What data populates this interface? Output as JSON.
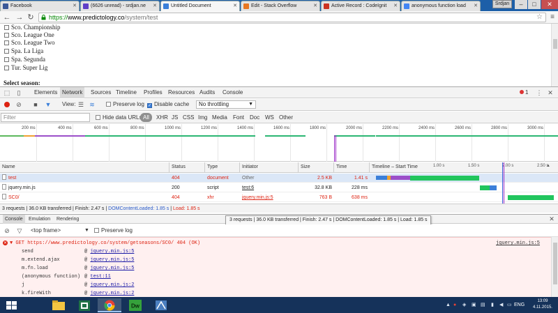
{
  "browser": {
    "tabs": [
      {
        "title": "Facebook",
        "favicon_color": "#3b5998"
      },
      {
        "title": "(6626 unread) - srdjan.ne",
        "favicon_color": "#5f3ec7"
      },
      {
        "title": "Untitled Document",
        "favicon_color": "#3b7fd9"
      },
      {
        "title": "Edit - Stack Overflow",
        "favicon_color": "#e87722"
      },
      {
        "title": "Active Record : CodeIgnit",
        "favicon_color": "#cc3322"
      },
      {
        "title": "anonymous function load",
        "favicon_color": "#4285f4"
      }
    ],
    "user_name": "Srdjan",
    "window_buttons": {
      "minimize": "–",
      "maximize": "□",
      "close": "✕"
    },
    "url": {
      "scheme": "https://",
      "host": "www.predictology.co",
      "path": "/system/test"
    }
  },
  "page": {
    "leagues": [
      "Sco. Championship",
      "Sco. League One",
      "Sco. League Two",
      "Spa. La Liga",
      "Spa. Segunda",
      "Tur. Super Lig"
    ],
    "select_season_label": "Select season:"
  },
  "devtools": {
    "tabs": [
      "Elements",
      "Network",
      "Sources",
      "Timeline",
      "Profiles",
      "Resources",
      "Audits",
      "Console"
    ],
    "active_tab": "Network",
    "error_count": "1",
    "network_toolbar": {
      "view_label": "View:",
      "preserve_log": "Preserve log",
      "disable_cache": "Disable cache",
      "throttle": "No throttling"
    },
    "filter": {
      "placeholder": "Filter",
      "hide_data_urls": "Hide data URLs",
      "types": [
        "All",
        "XHR",
        "JS",
        "CSS",
        "Img",
        "Media",
        "Font",
        "Doc",
        "WS",
        "Other"
      ]
    },
    "overview_ticks": [
      "200 ms",
      "400 ms",
      "600 ms",
      "800 ms",
      "1000 ms",
      "1200 ms",
      "1400 ms",
      "1600 ms",
      "1800 ms",
      "2000 ms",
      "2200 ms",
      "2400 ms",
      "2600 ms",
      "2800 ms",
      "3000 ms"
    ],
    "columns": [
      "Name",
      "Status",
      "Type",
      "Initiator",
      "Size",
      "Time",
      "Timeline – Start Time"
    ],
    "waterfall_ticks": [
      "1.00 s",
      "1.50 s",
      "2.00 s",
      "2.50 s"
    ],
    "requests": [
      {
        "name": "test",
        "status": "404",
        "type": "document",
        "initiator": "Other",
        "size": "2.5 KB",
        "time": "1.41 s"
      },
      {
        "name": "jquery.min.js",
        "status": "200",
        "type": "script",
        "initiator": "test:6",
        "size": "32.8 KB",
        "time": "228 ms"
      },
      {
        "name": "SC0/",
        "status": "404",
        "type": "xhr",
        "initiator": "jquery.min.js:5",
        "size": "763 B",
        "time": "638 ms"
      }
    ],
    "summary": {
      "main": "3 requests | 36.0 KB transferred | Finish: 2.47 s | ",
      "dom": "DOMContentLoaded: 1.85 s",
      "sep": " | ",
      "load": "Load: 1.85 s"
    },
    "tooltip": "3 requests | 36.0 KB transferred | Finish: 2.47 s | DOMContentLoaded: 1.85 s | Load: 1.85 s",
    "drawer_tabs": [
      "Console",
      "Emulation",
      "Rendering"
    ],
    "console": {
      "frame": "<top frame>",
      "preserve_log": "Preserve log",
      "error_line": "▼ GET https://www.predictology.co/system/getseasons/SC0/ 404 (OK)",
      "error_location": "jquery.min.js:5",
      "stack": [
        {
          "fn": "send",
          "loc": "jquery.min.js:5"
        },
        {
          "fn": "m.extend.ajax",
          "loc": "jquery.min.js:5"
        },
        {
          "fn": "m.fn.load",
          "loc": "jquery.min.js:5"
        },
        {
          "fn": "(anonymous function)",
          "loc": "test:11"
        },
        {
          "fn": "j",
          "loc": "jquery.min.js:2"
        },
        {
          "fn": "k.fireWith",
          "loc": "jquery.min.js:2"
        }
      ]
    }
  },
  "taskbar": {
    "apps": [
      {
        "name": "start-button",
        "color": "#ffffff"
      },
      {
        "name": "file-explorer",
        "color": "#f4c542"
      },
      {
        "name": "excel",
        "color": "#1e7145"
      },
      {
        "name": "chrome",
        "color": "#e94235"
      },
      {
        "name": "dreamweaver",
        "color": "#35a13b"
      },
      {
        "name": "sql-tool",
        "color": "#4b7fc0"
      }
    ],
    "language": "ENG",
    "time": "13:09",
    "date": "4.11.2015."
  }
}
